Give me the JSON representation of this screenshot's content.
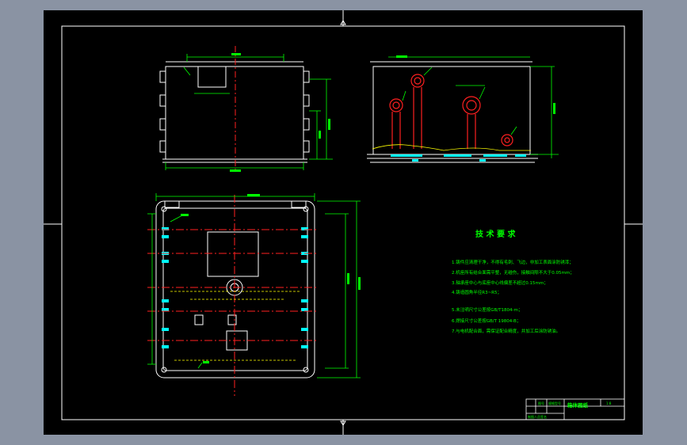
{
  "colors": {
    "app_background": "#8a93a3",
    "canvas": "#000000",
    "frame": "#ffffff",
    "outline": "#ffffff",
    "dimension": "#00ff00",
    "centerline": "#ff2020",
    "hidden": "#ffff00",
    "hatch": "#00ffff",
    "text": "#00ff00"
  },
  "notes": {
    "title": "技 术 要 求",
    "items": [
      "1.铸件应清理干净，不得有毛刺、飞边，非加工表面涂防锈漆；",
      "2.机座所有结合面需平整，无碰伤，接触间隙不大于0.05mm；",
      "3.轴承座中心与底座中心线偏差不超过0.15mm；",
      "4.铸造圆角半径R3~R5；",
      "5.未注明尺寸公差按GB/T1804-m；",
      "6.焊接尺寸公差按GB/T 19804-B；",
      "7.与电机配合面，需保证配合精度，并加工后涂防锈油。"
    ]
  },
  "title_block": {
    "row1": [
      "图号",
      "规格型号",
      "",
      "箱体图纸",
      "1:8"
    ],
    "row2": [
      "",
      "",
      "",
      "",
      ""
    ],
    "row3": [
      "制图人员签名",
      "",
      "",
      "",
      ""
    ]
  }
}
